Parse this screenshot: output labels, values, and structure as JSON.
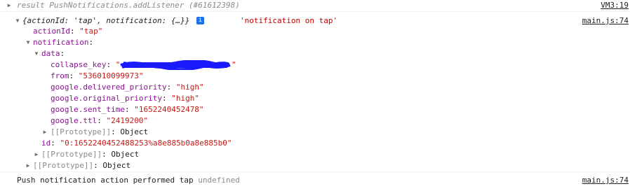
{
  "lines": {
    "result": {
      "prefix": "result",
      "text": "PushNotifications.addListener (#61612398)",
      "source": "VM3:19"
    },
    "summary": {
      "text": "{actionId: 'tap', notification: {…}}",
      "info": "i",
      "message": "'notification on tap'",
      "source": "main.js:74"
    },
    "actionId": {
      "key": "actionId",
      "sep": ": ",
      "value": "\"tap\""
    },
    "notification": {
      "key": "notification",
      "sep": ":"
    },
    "data": {
      "key": "data",
      "sep": ":"
    },
    "collapse_key": {
      "key": "collapse_key",
      "sep": ": ",
      "value_start": "\"",
      "value_end": "\""
    },
    "from": {
      "key": "from",
      "sep": ": ",
      "value": "\"536010099973\""
    },
    "delivered_priority": {
      "key": "google.delivered_priority",
      "sep": ": ",
      "value": "\"high\""
    },
    "original_priority": {
      "key": "google.original_priority",
      "sep": ": ",
      "value": "\"high\""
    },
    "sent_time": {
      "key": "google.sent_time",
      "sep": ": ",
      "value": "\"1652240452478\""
    },
    "ttl": {
      "key": "google.ttl",
      "sep": ": ",
      "value": "\"2419200\""
    },
    "proto_data": {
      "text": "[[Prototype]]",
      "sep": ": ",
      "value": "Object"
    },
    "id": {
      "key": "id",
      "sep": ": ",
      "value": "\"0:1652240452488253%a8e885b0a8e885b0\""
    },
    "proto_notification": {
      "text": "[[Prototype]]",
      "sep": ": ",
      "value": "Object"
    },
    "proto_root": {
      "text": "[[Prototype]]",
      "sep": ": ",
      "value": "Object"
    },
    "push": {
      "text": "Push notification action performed tap",
      "value": "undefined",
      "source": "main.js:74"
    }
  },
  "icons": {
    "expanded": "triangle-down",
    "collapsed": "triangle-right"
  },
  "colors": {
    "key": "#881391",
    "string": "#c41a16",
    "info_badge": "#1a73e8",
    "redaction": "#1a1aff"
  }
}
